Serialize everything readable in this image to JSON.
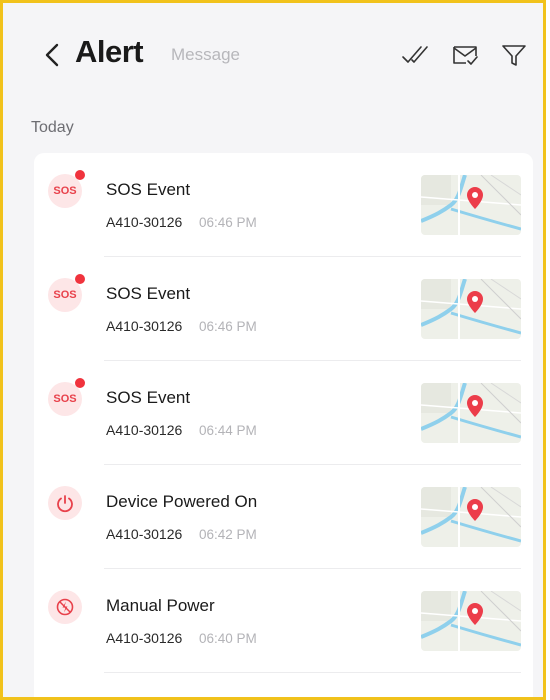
{
  "header": {
    "title": "Alert",
    "subtitle": "Message",
    "icons": [
      "back-icon",
      "mark-all-read-icon",
      "mail-check-icon",
      "filter-icon"
    ]
  },
  "section": {
    "label": "Today"
  },
  "alerts": [
    {
      "title": "SOS Event",
      "device": "A410-30126",
      "time": "06:46 PM",
      "icon": "sos",
      "badge_text": "SOS",
      "unread": true
    },
    {
      "title": "SOS Event",
      "device": "A410-30126",
      "time": "06:46 PM",
      "icon": "sos",
      "badge_text": "SOS",
      "unread": true
    },
    {
      "title": "SOS Event",
      "device": "A410-30126",
      "time": "06:44 PM",
      "icon": "sos",
      "badge_text": "SOS",
      "unread": true
    },
    {
      "title": "Device Powered On",
      "device": "A410-30126",
      "time": "06:42 PM",
      "icon": "power-icon",
      "unread": false
    },
    {
      "title": "Manual Power",
      "device": "A410-30126",
      "time": "06:40 PM",
      "icon": "power-off-icon",
      "unread": false
    }
  ],
  "colors": {
    "accent": "#e8414b",
    "frame": "#f1c21b",
    "badge_bg": "#fde6e7",
    "background": "#f5f5f7"
  }
}
